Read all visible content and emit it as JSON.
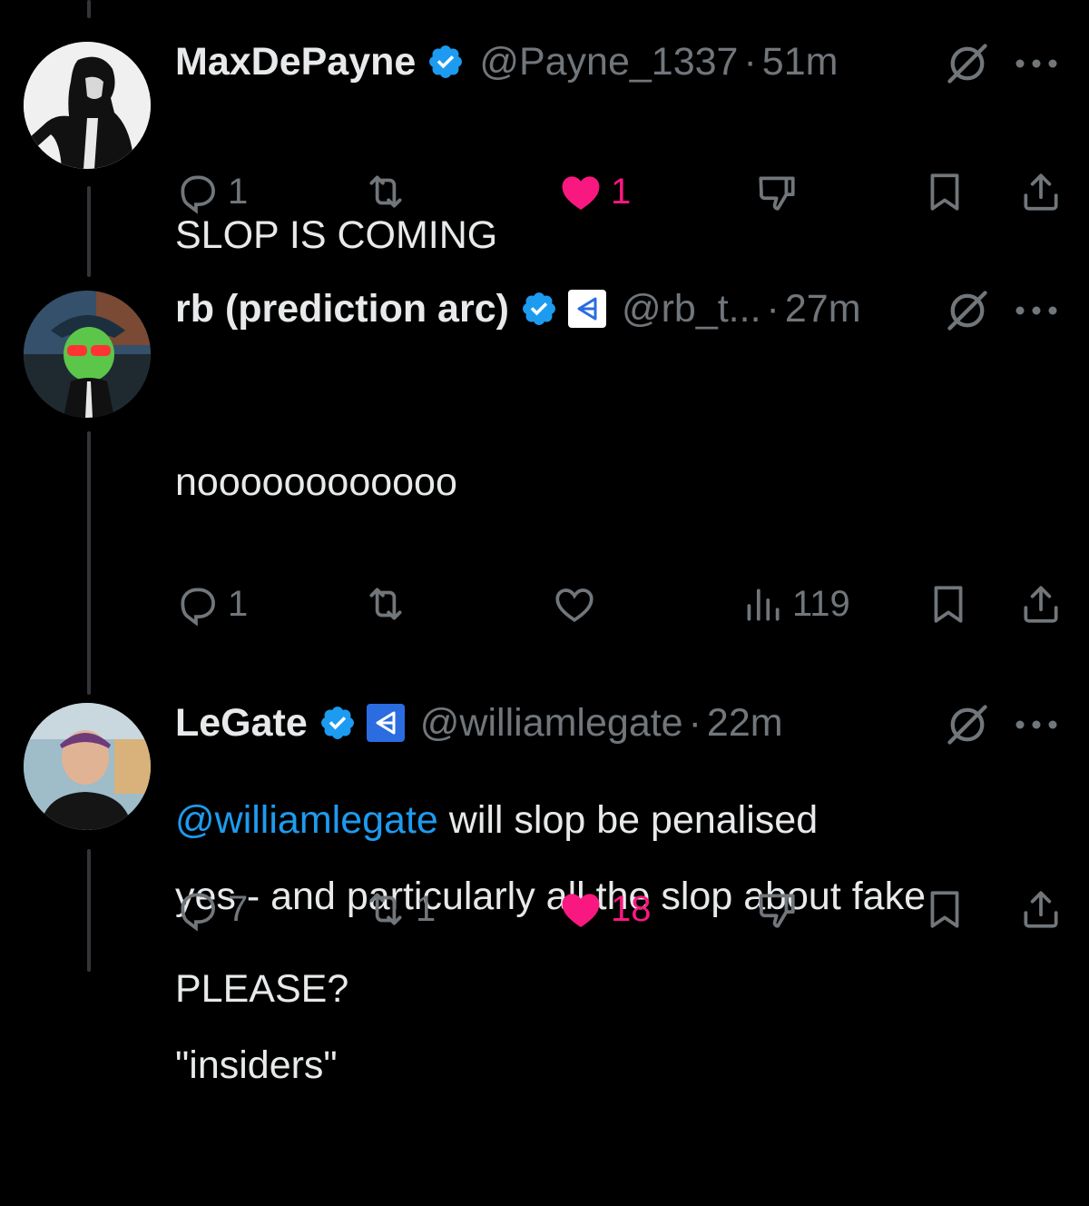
{
  "colors": {
    "background": "#000000",
    "text": "#e7e9ea",
    "muted": "#71767b",
    "link": "#1d9bf0",
    "like": "#f91880",
    "verified": "#1d9bf0"
  },
  "tweets": [
    {
      "name": "MaxDePayne",
      "handle": "@Payne_1337",
      "dot": "·",
      "time": "51m",
      "text_lines": [
        "SLOP IS COMING"
      ],
      "actions": {
        "reply_count": "1",
        "repost_count": "",
        "like_count": "1",
        "liked": true,
        "views": ""
      },
      "icons": [
        "reply-icon",
        "repost-icon",
        "heart-filled-icon",
        "downvote-icon",
        "bookmark-icon",
        "share-icon"
      ]
    },
    {
      "name": "rb (prediction arc)",
      "handle": "@rb_t...",
      "dot": "·",
      "time": "27m",
      "line1": "noooooooooooo",
      "mention": "@williamlegate",
      "line2_rest": " will slop be penalised",
      "line3": "PLEASE?",
      "actions": {
        "reply_count": "1",
        "repost_count": "",
        "like_count": "",
        "liked": false,
        "views": "119"
      },
      "icons": [
        "reply-icon",
        "repost-icon",
        "heart-outline-icon",
        "views-icon",
        "bookmark-icon",
        "share-icon"
      ]
    },
    {
      "name": "LeGate",
      "handle": "@williamlegate",
      "dot": "·",
      "time": "22m",
      "text_lines": [
        "yes - and particularly all the slop about fake",
        "\"insiders\""
      ],
      "actions": {
        "reply_count": "7",
        "repost_count": "1",
        "like_count": "18",
        "liked": true,
        "views": ""
      },
      "icons": [
        "reply-icon",
        "repost-icon",
        "heart-filled-icon",
        "downvote-icon",
        "bookmark-icon",
        "share-icon"
      ]
    }
  ]
}
